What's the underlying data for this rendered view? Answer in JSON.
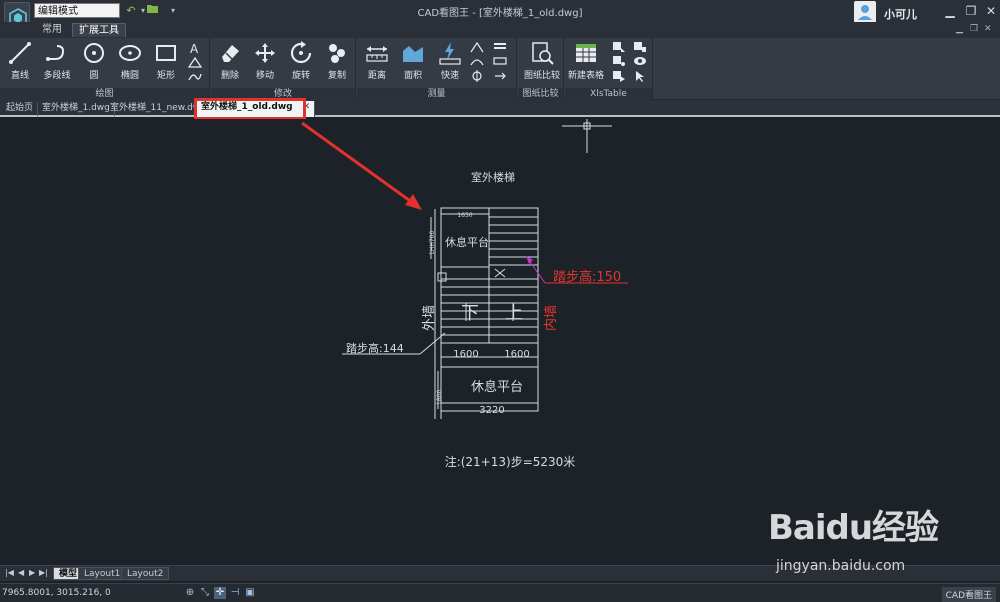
{
  "titlebar": {
    "mode_select": "编辑模式",
    "title": "CAD看图王 - [室外楼梯_1_old.dwg]",
    "user_name": "小可儿",
    "min": "▁",
    "restore": "❐",
    "close": "✕"
  },
  "ribbon_tabs": [
    {
      "label": "常用"
    },
    {
      "label": "扩展工具"
    }
  ],
  "ribbon": {
    "draw": {
      "title": "绘图",
      "line": "直线",
      "polyline": "多段线",
      "circle": "圆",
      "ellipse": "椭圆",
      "rect": "矩形"
    },
    "modify": {
      "title": "修改",
      "delete": "删除",
      "move": "移动",
      "rotate": "旋转",
      "copy": "复制"
    },
    "measure": {
      "title": "测量",
      "distance": "距离",
      "area": "面积",
      "quick": "快速"
    },
    "compare": {
      "title": "图纸比较",
      "compare": "图纸比较"
    },
    "xls": {
      "title": "XlsTable",
      "new_table": "新建表格"
    }
  },
  "doctabs": [
    {
      "label": "起始页"
    },
    {
      "label": "室外楼梯_1.dwg"
    },
    {
      "label": "室外楼梯_11_new.dwg"
    },
    {
      "label": "室外楼梯_1_old.dwg"
    }
  ],
  "drawing": {
    "title": "室外楼梯",
    "landing_top": "休息平台",
    "landing_bottom": "休息平台",
    "step_right": "踏步高:150",
    "step_left": "踏步高:144",
    "outer_wall": "外墙",
    "inner_wall": "内墙",
    "down": "下",
    "up": "上",
    "dim_left": "1600",
    "dim_right": "1600",
    "dim_total": "3220",
    "dim_top": "1650",
    "dim_vertical": "1800",
    "dim_vertical2": "1HH700",
    "note": "注:(21+13)步=5230米",
    "colors": {
      "stroke": "#d7dce1",
      "red_label": "#e4352f",
      "magenta": "#cc33cc",
      "arrow": "#e3312e"
    }
  },
  "layout_tabs": [
    {
      "label": "模型"
    },
    {
      "label": "Layout1"
    },
    {
      "label": "Layout2"
    }
  ],
  "statusbar": {
    "coords": "7965.8001, 3015.216, 0",
    "brand": "CAD看图王"
  },
  "watermark": {
    "logo": "Baidu经验",
    "url": "jingyan.baidu.com"
  }
}
